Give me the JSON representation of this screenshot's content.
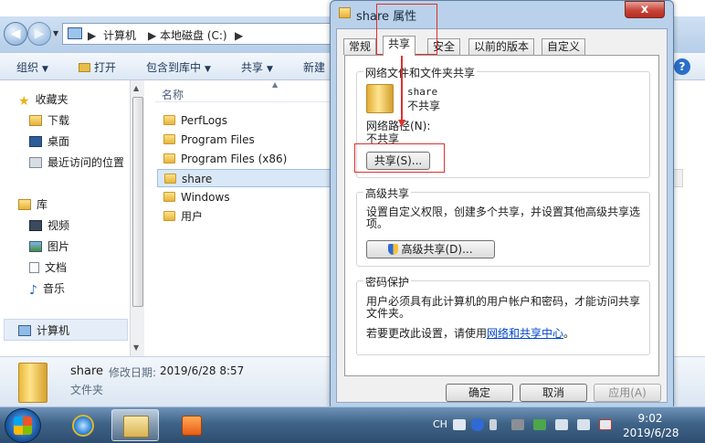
{
  "explorer": {
    "breadcrumb": [
      "计算机",
      "本地磁盘 (C:)"
    ],
    "toolbar": {
      "organize": "组织",
      "open": "打开",
      "include_in_library": "包含到库中",
      "share": "共享",
      "new": "新建"
    },
    "nav": {
      "favorites": "收藏夹",
      "downloads": "下载",
      "desktop": "桌面",
      "recent": "最近访问的位置",
      "libraries": "库",
      "videos": "视频",
      "pictures": "图片",
      "documents": "文档",
      "music": "音乐",
      "computer": "计算机"
    },
    "column_name": "名称",
    "files": [
      "PerfLogs",
      "Program Files",
      "Program Files (x86)",
      "share",
      "Windows",
      "用户"
    ],
    "details": {
      "name": "share",
      "modified_label": "修改日期:",
      "modified_value": "2019/6/28 8:57",
      "type": "文件夹"
    }
  },
  "dialog": {
    "title": "share 属性",
    "close": "x",
    "tabs": [
      "常规",
      "共享",
      "安全",
      "以前的版本",
      "自定义"
    ],
    "network_group": {
      "title": "网络文件和文件夹共享",
      "folder_name": "share",
      "status": "不共享",
      "path_label": "网络路径(N):",
      "path_value": "不共享",
      "share_button": "共享(S)..."
    },
    "advanced_group": {
      "title": "高级共享",
      "desc_line1": "设置自定义权限，创建多个共享，并设置其他高级共享选",
      "desc_line2": "项。",
      "button": "高级共享(D)..."
    },
    "password_group": {
      "title": "密码保护",
      "desc_line1": "用户必须具有此计算机的用户帐户和密码，才能访问共享",
      "desc_line2": "文件夹。",
      "change_prefix": "若要更改此设置，请使用",
      "link": "网络和共享中心",
      "change_suffix": "。"
    },
    "buttons": {
      "ok": "确定",
      "cancel": "取消",
      "apply": "应用(A)"
    }
  },
  "taskbar": {
    "lang": "CH",
    "time": "9:02",
    "date": "2019/6/28"
  }
}
